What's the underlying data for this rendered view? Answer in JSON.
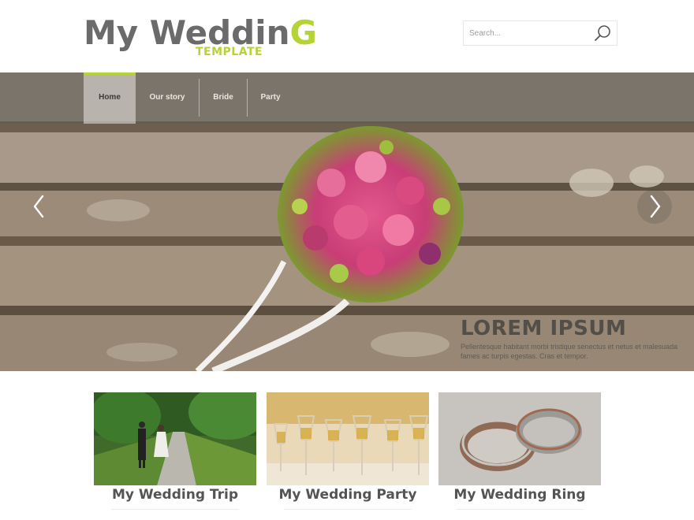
{
  "logo": {
    "main_a": "My Weddin",
    "main_b": "G",
    "sub": "TEMPLATE"
  },
  "search": {
    "placeholder": "Search..."
  },
  "nav": {
    "items": [
      {
        "label": "Home",
        "active": true
      },
      {
        "label": "Our story",
        "active": false
      },
      {
        "label": "Bride",
        "active": false
      },
      {
        "label": "Party",
        "active": false
      }
    ]
  },
  "slider": {
    "prev_icon": "chevron-left-icon",
    "next_icon": "chevron-right-icon",
    "caption_title": "LOREM IPSUM",
    "caption_text": "Pellentesque habitant morbi tristique senectus et netus et malesuada fames ac turpis egestas. Cras et tempor."
  },
  "cards": [
    {
      "title": "My Wedding Trip"
    },
    {
      "title": "My Wedding Party"
    },
    {
      "title": "My Wedding Ring"
    }
  ],
  "colors": {
    "accent": "#b5d335",
    "logo_gray": "#6b6b6b",
    "card_title": "#545454"
  }
}
